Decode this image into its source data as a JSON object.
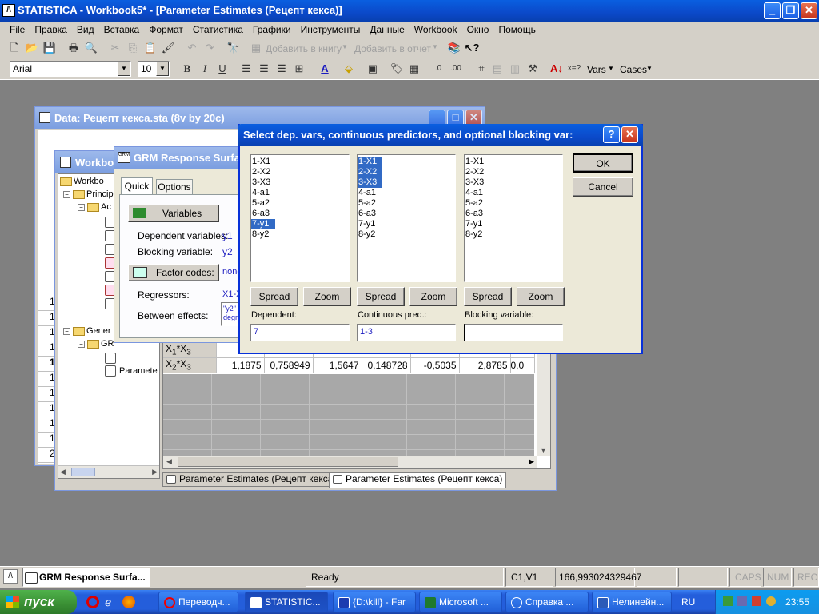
{
  "app": {
    "title": "STATISTICA - Workbook5* - [Parameter Estimates (Рецепт кекса)]"
  },
  "menu": [
    "File",
    "Правка",
    "Вид",
    "Вставка",
    "Формат",
    "Статистика",
    "Графики",
    "Инструменты",
    "Данные",
    "Workbook",
    "Окно",
    "Помощь"
  ],
  "toolbar": {
    "add_to_book": "Добавить в книгу",
    "add_to_report": "Добавить в отчет",
    "font_name": "Arial",
    "font_size": "10",
    "vars_label": "Vars",
    "cases_label": "Cases"
  },
  "data_window": {
    "title": "Data: Рецепт кекса.sta (8v by 20c)",
    "row_numbers": [
      "1",
      "1",
      "1",
      "1",
      "1",
      "1",
      "1",
      "1",
      "1",
      "1",
      "2"
    ]
  },
  "workbook": {
    "title": "Workbo",
    "tree": [
      "Workbo",
      "Princip",
      "Ac",
      "Gener",
      "GR",
      "Paramete"
    ]
  },
  "grm": {
    "title": "GRM Response Surfac",
    "tabs": [
      "Quick",
      "Options"
    ],
    "variables_btn": "Variables",
    "dependent_label": "Dependent variables:",
    "dependent_value": "y1",
    "blocking_label": "Blocking variable:",
    "blocking_value": "y2",
    "factor_codes_btn": "Factor codes:",
    "factor_codes_value": "none",
    "regressors_label": "Regressors:",
    "regressors_value": "X1-X",
    "between_label": "Between effects:",
    "between_value_1": "\"y2\"",
    "between_value_2": "degr"
  },
  "spreadsheet": {
    "rows": [
      {
        "label": "X1*X3",
        "cells": [
          "0",
          "",
          "",
          "",
          "",
          "",
          ""
        ]
      },
      {
        "label": "X2*X3",
        "cells": [
          "1,1875",
          "0,758949",
          "1,5647",
          "0,148728",
          "-0,5035",
          "2,8785",
          "0,0"
        ]
      }
    ],
    "tabs": [
      "Parameter Estimates (Рецепт кекса)",
      "Parameter Estimates (Рецепт кекса)"
    ]
  },
  "dialog": {
    "title": "Select dep. vars, continuous predictors, and optional blocking var:",
    "variables": [
      "1-X1",
      "2-X2",
      "3-X3",
      "4-a1",
      "5-a2",
      "6-a3",
      "7-y1",
      "8-y2"
    ],
    "ok": "OK",
    "cancel": "Cancel",
    "spread": "Spread",
    "zoom": "Zoom",
    "dependent_label": "Dependent:",
    "dependent_value": "7",
    "continuous_label": "Continuous pred.:",
    "continuous_value": "1-3",
    "blocking_label": "Blocking variable:",
    "blocking_value": ""
  },
  "statusbar": {
    "window": "GRM Response Surfa...",
    "ready": "Ready",
    "cell": "C1,V1",
    "value": "166,993024329467",
    "caps": "CAPS",
    "num": "NUM",
    "rec": "REC"
  },
  "taskbar": {
    "start": "пуск",
    "items": [
      "Переводч...",
      "STATISTIC...",
      "{D:\\kill} - Far",
      "Microsoft ...",
      "Справка ...",
      "Нелинейн..."
    ],
    "lang": "RU",
    "clock": "23:55"
  }
}
